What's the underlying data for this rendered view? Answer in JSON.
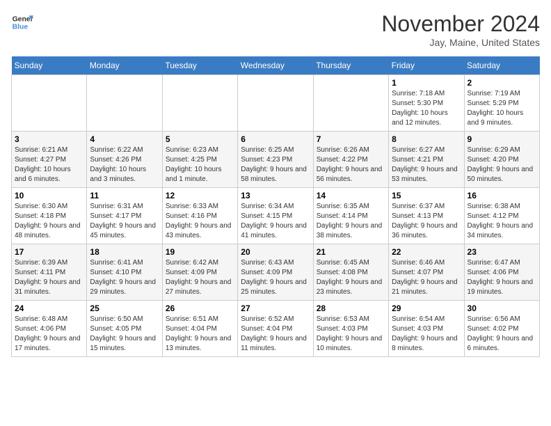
{
  "header": {
    "logo_line1": "General",
    "logo_line2": "Blue",
    "month": "November 2024",
    "location": "Jay, Maine, United States"
  },
  "weekdays": [
    "Sunday",
    "Monday",
    "Tuesday",
    "Wednesday",
    "Thursday",
    "Friday",
    "Saturday"
  ],
  "weeks": [
    [
      {
        "day": "",
        "info": ""
      },
      {
        "day": "",
        "info": ""
      },
      {
        "day": "",
        "info": ""
      },
      {
        "day": "",
        "info": ""
      },
      {
        "day": "",
        "info": ""
      },
      {
        "day": "1",
        "info": "Sunrise: 7:18 AM\nSunset: 5:30 PM\nDaylight: 10 hours and 12 minutes."
      },
      {
        "day": "2",
        "info": "Sunrise: 7:19 AM\nSunset: 5:29 PM\nDaylight: 10 hours and 9 minutes."
      }
    ],
    [
      {
        "day": "3",
        "info": "Sunrise: 6:21 AM\nSunset: 4:27 PM\nDaylight: 10 hours and 6 minutes."
      },
      {
        "day": "4",
        "info": "Sunrise: 6:22 AM\nSunset: 4:26 PM\nDaylight: 10 hours and 3 minutes."
      },
      {
        "day": "5",
        "info": "Sunrise: 6:23 AM\nSunset: 4:25 PM\nDaylight: 10 hours and 1 minute."
      },
      {
        "day": "6",
        "info": "Sunrise: 6:25 AM\nSunset: 4:23 PM\nDaylight: 9 hours and 58 minutes."
      },
      {
        "day": "7",
        "info": "Sunrise: 6:26 AM\nSunset: 4:22 PM\nDaylight: 9 hours and 56 minutes."
      },
      {
        "day": "8",
        "info": "Sunrise: 6:27 AM\nSunset: 4:21 PM\nDaylight: 9 hours and 53 minutes."
      },
      {
        "day": "9",
        "info": "Sunrise: 6:29 AM\nSunset: 4:20 PM\nDaylight: 9 hours and 50 minutes."
      }
    ],
    [
      {
        "day": "10",
        "info": "Sunrise: 6:30 AM\nSunset: 4:18 PM\nDaylight: 9 hours and 48 minutes."
      },
      {
        "day": "11",
        "info": "Sunrise: 6:31 AM\nSunset: 4:17 PM\nDaylight: 9 hours and 45 minutes."
      },
      {
        "day": "12",
        "info": "Sunrise: 6:33 AM\nSunset: 4:16 PM\nDaylight: 9 hours and 43 minutes."
      },
      {
        "day": "13",
        "info": "Sunrise: 6:34 AM\nSunset: 4:15 PM\nDaylight: 9 hours and 41 minutes."
      },
      {
        "day": "14",
        "info": "Sunrise: 6:35 AM\nSunset: 4:14 PM\nDaylight: 9 hours and 38 minutes."
      },
      {
        "day": "15",
        "info": "Sunrise: 6:37 AM\nSunset: 4:13 PM\nDaylight: 9 hours and 36 minutes."
      },
      {
        "day": "16",
        "info": "Sunrise: 6:38 AM\nSunset: 4:12 PM\nDaylight: 9 hours and 34 minutes."
      }
    ],
    [
      {
        "day": "17",
        "info": "Sunrise: 6:39 AM\nSunset: 4:11 PM\nDaylight: 9 hours and 31 minutes."
      },
      {
        "day": "18",
        "info": "Sunrise: 6:41 AM\nSunset: 4:10 PM\nDaylight: 9 hours and 29 minutes."
      },
      {
        "day": "19",
        "info": "Sunrise: 6:42 AM\nSunset: 4:09 PM\nDaylight: 9 hours and 27 minutes."
      },
      {
        "day": "20",
        "info": "Sunrise: 6:43 AM\nSunset: 4:09 PM\nDaylight: 9 hours and 25 minutes."
      },
      {
        "day": "21",
        "info": "Sunrise: 6:45 AM\nSunset: 4:08 PM\nDaylight: 9 hours and 23 minutes."
      },
      {
        "day": "22",
        "info": "Sunrise: 6:46 AM\nSunset: 4:07 PM\nDaylight: 9 hours and 21 minutes."
      },
      {
        "day": "23",
        "info": "Sunrise: 6:47 AM\nSunset: 4:06 PM\nDaylight: 9 hours and 19 minutes."
      }
    ],
    [
      {
        "day": "24",
        "info": "Sunrise: 6:48 AM\nSunset: 4:06 PM\nDaylight: 9 hours and 17 minutes."
      },
      {
        "day": "25",
        "info": "Sunrise: 6:50 AM\nSunset: 4:05 PM\nDaylight: 9 hours and 15 minutes."
      },
      {
        "day": "26",
        "info": "Sunrise: 6:51 AM\nSunset: 4:04 PM\nDaylight: 9 hours and 13 minutes."
      },
      {
        "day": "27",
        "info": "Sunrise: 6:52 AM\nSunset: 4:04 PM\nDaylight: 9 hours and 11 minutes."
      },
      {
        "day": "28",
        "info": "Sunrise: 6:53 AM\nSunset: 4:03 PM\nDaylight: 9 hours and 10 minutes."
      },
      {
        "day": "29",
        "info": "Sunrise: 6:54 AM\nSunset: 4:03 PM\nDaylight: 9 hours and 8 minutes."
      },
      {
        "day": "30",
        "info": "Sunrise: 6:56 AM\nSunset: 4:02 PM\nDaylight: 9 hours and 6 minutes."
      }
    ]
  ]
}
